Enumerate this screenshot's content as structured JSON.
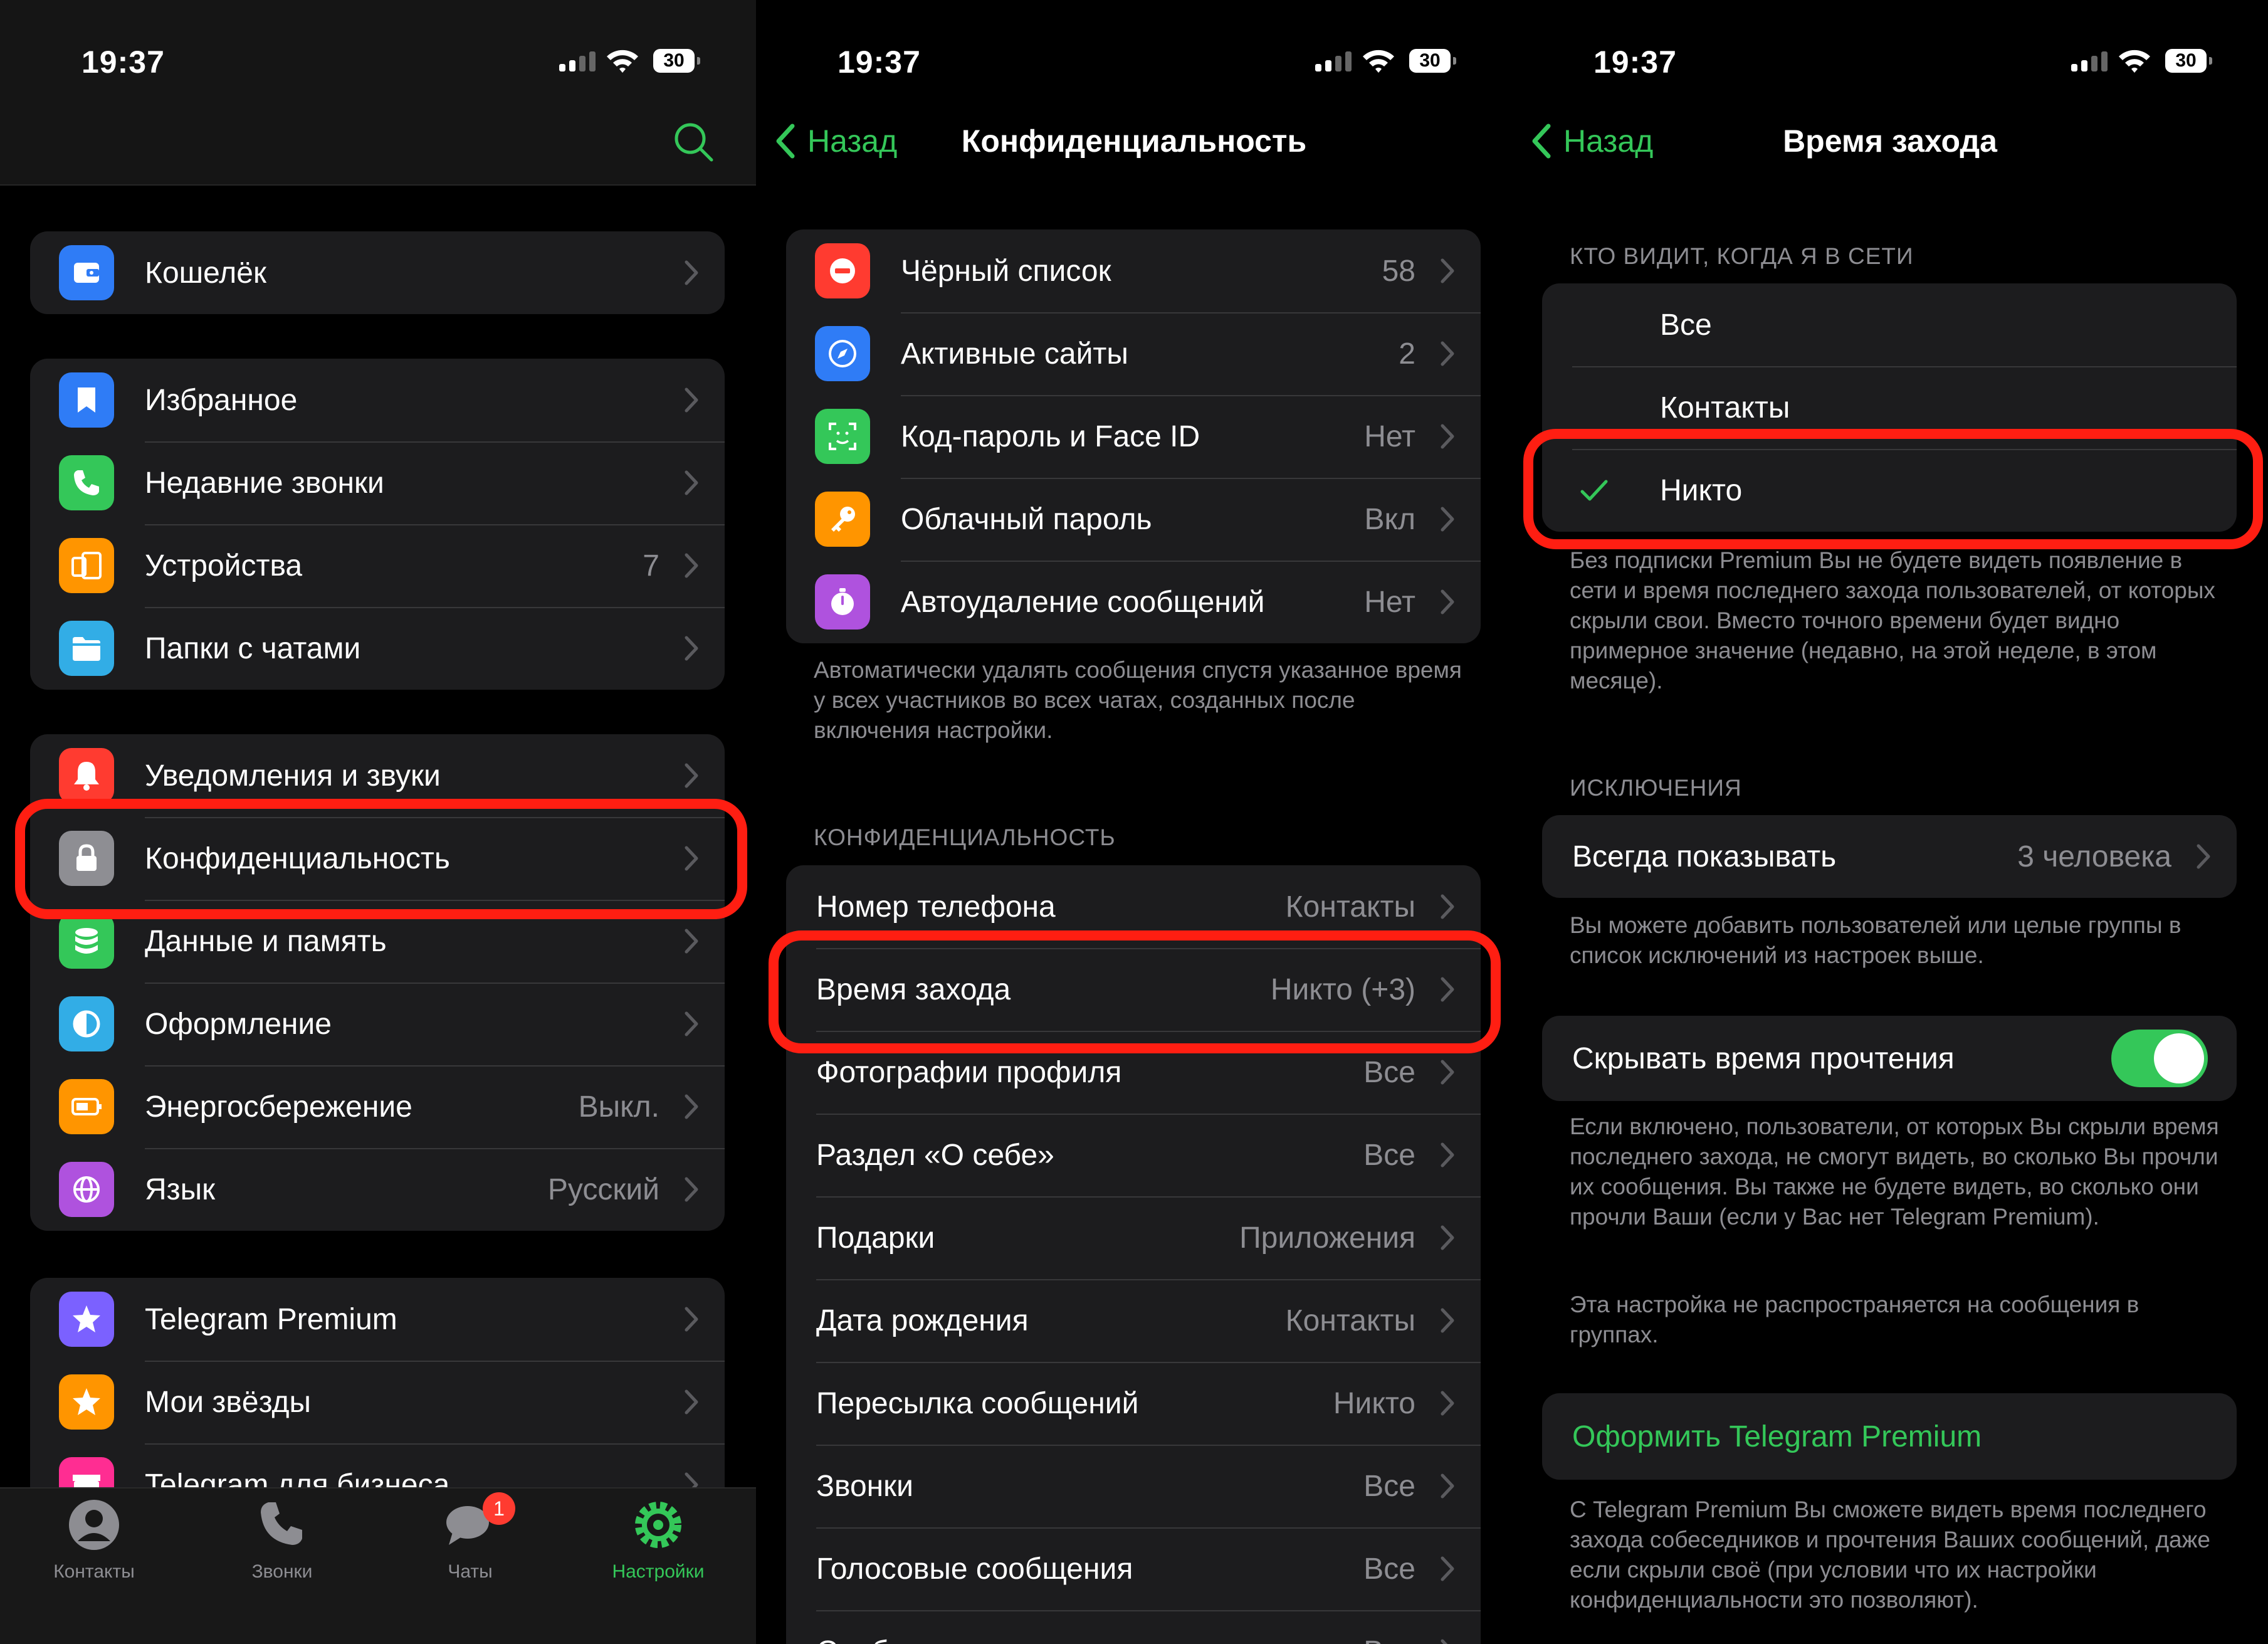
{
  "status_bar": {
    "time": "19:37",
    "battery": "30"
  },
  "screen1": {
    "group1": [
      {
        "label": "Кошелёк",
        "icon": "wallet-icon",
        "color": "#2f7cf6"
      }
    ],
    "group2": [
      {
        "label": "Избранное",
        "icon": "bookmark-icon",
        "color": "#2f7cf6"
      },
      {
        "label": "Недавние звонки",
        "icon": "phone-icon",
        "color": "#34c759"
      },
      {
        "label": "Устройства",
        "value": "7",
        "icon": "devices-icon",
        "color": "#ff9500"
      },
      {
        "label": "Папки с чатами",
        "icon": "folder-icon",
        "color": "#32ade6"
      }
    ],
    "group3": [
      {
        "label": "Уведомления и звуки",
        "icon": "bell-icon",
        "color": "#ff3b30"
      },
      {
        "label": "Конфиденциальность",
        "icon": "lock-icon",
        "color": "#8e8e93"
      },
      {
        "label": "Данные и память",
        "icon": "database-icon",
        "color": "#34c759"
      },
      {
        "label": "Оформление",
        "icon": "appearance-icon",
        "color": "#32ade6"
      },
      {
        "label": "Энергосбережение",
        "value": "Выкл.",
        "icon": "battery-icon",
        "color": "#ff9500"
      },
      {
        "label": "Язык",
        "value": "Русский",
        "icon": "globe-icon",
        "color": "#af52de"
      }
    ],
    "group4": [
      {
        "label": "Telegram Premium",
        "icon": "premium-star-icon",
        "color": "#7b61ff"
      },
      {
        "label": "Мои звёзды",
        "icon": "star-icon",
        "color": "#ff9500"
      },
      {
        "label": "Telegram для бизнеса",
        "icon": "business-icon",
        "color": "#ff2d92"
      }
    ],
    "tabs": [
      {
        "label": "Контакты"
      },
      {
        "label": "Звонки"
      },
      {
        "label": "Чаты",
        "badge": "1"
      },
      {
        "label": "Настройки"
      }
    ]
  },
  "screen2": {
    "back": "Назад",
    "title": "Конфиденциальность",
    "security": [
      {
        "label": "Чёрный список",
        "value": "58",
        "icon": "blocked-icon",
        "color": "#ff3b30"
      },
      {
        "label": "Активные сайты",
        "value": "2",
        "icon": "compass-icon",
        "color": "#2f7cf6"
      },
      {
        "label": "Код-пароль и Face ID",
        "value": "Нет",
        "icon": "faceid-icon",
        "color": "#34c759"
      },
      {
        "label": "Облачный пароль",
        "value": "Вкл",
        "icon": "key-icon",
        "color": "#ff9500"
      },
      {
        "label": "Автоудаление сообщений",
        "value": "Нет",
        "icon": "timer-icon",
        "color": "#af52de"
      }
    ],
    "autodelete_note": "Автоматически удалять сообщения спустя указанное время у всех участников во всех чатах, созданных после включения настройки.",
    "privacy_header": "КОНФИДЕНЦИАЛЬНОСТЬ",
    "privacy": [
      {
        "label": "Номер телефона",
        "value": "Контакты"
      },
      {
        "label": "Время захода",
        "value": "Никто (+3)"
      },
      {
        "label": "Фотографии профиля",
        "value": "Все"
      },
      {
        "label": "Раздел «О себе»",
        "value": "Все"
      },
      {
        "label": "Подарки",
        "value": "Приложения"
      },
      {
        "label": "Дата рождения",
        "value": "Контакты"
      },
      {
        "label": "Пересылка сообщений",
        "value": "Никто"
      },
      {
        "label": "Звонки",
        "value": "Все"
      },
      {
        "label": "Голосовые сообщения",
        "value": "Все"
      },
      {
        "label": "Сообщения",
        "value": "Все"
      }
    ]
  },
  "screen3": {
    "back": "Назад",
    "title": "Время захода",
    "who_header": "КТО ВИДИТ, КОГДА Я В СЕТИ",
    "options": [
      {
        "label": "Все",
        "selected": false
      },
      {
        "label": "Контакты",
        "selected": false
      },
      {
        "label": "Никто",
        "selected": true
      }
    ],
    "who_note": "Без подписки Premium Вы не будете видеть появление в сети и время последнего захода пользователей, от которых скрыли свои. Вместо точного времени будет видно примерное значение (недавно, на этой неделе, в этом месяце).",
    "exceptions_header": "ИСКЛЮЧЕНИЯ",
    "always_show": {
      "label": "Всегда показывать",
      "value": "3 человека"
    },
    "exceptions_note": "Вы можете добавить пользователей или целые группы в список исключений из настроек выше.",
    "hide_read": {
      "label": "Скрывать время прочтения",
      "on": true
    },
    "hide_note1": "Если включено, пользователи, от которых Вы скрыли время последнего захода, не смогут видеть, во сколько Вы прочли их сообщения. Вы также не будете видеть, во сколько они прочли Ваши (если у Вас нет Telegram Premium).",
    "hide_note2": "Эта настройка не распространяется на сообщения в группах.",
    "premium_link": "Оформить Telegram Premium",
    "premium_note": "С Telegram Premium Вы сможете видеть время последнего захода собеседников и прочтения Ваших сообщений, даже если скрыли своё (при условии что их настройки конфиденциальности это позволяют)."
  }
}
